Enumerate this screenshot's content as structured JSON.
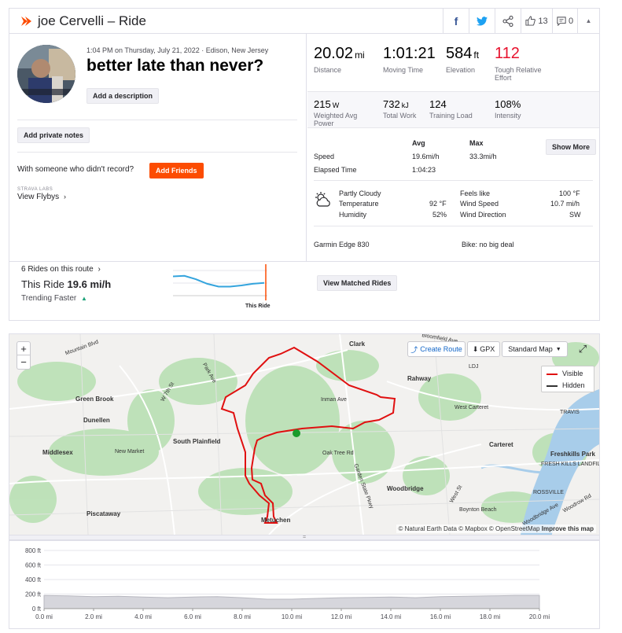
{
  "header": {
    "title": "joe Cervelli – Ride",
    "kudos_count": "13",
    "comment_count": "0"
  },
  "activity": {
    "meta": "1:04 PM on Thursday, July 21, 2022 · Edison, New Jersey",
    "name": "better late than never?",
    "add_description": "Add a description",
    "add_private_notes": "Add private notes",
    "with_someone": "With someone who didn't record?",
    "add_friends": "Add Friends",
    "labs": "STRAVA LABS",
    "flybys": "View Flybys"
  },
  "segment_compare": {
    "rides_on_route": "6 Rides on this route",
    "this_ride_label": "This Ride",
    "this_ride_value": "19.6 mi/h",
    "trend": "Trending Faster",
    "this_ride_marker": "This Ride",
    "matched_button": "View Matched Rides",
    "sparkline": [
      0.32,
      0.3,
      0.42,
      0.58,
      0.68,
      0.68,
      0.64,
      0.58,
      0.55
    ]
  },
  "stats_primary": [
    {
      "value": "20.02",
      "unit": "mi",
      "label": "Distance"
    },
    {
      "value": "1:01:21",
      "unit": "",
      "label": "Moving Time"
    },
    {
      "value": "584",
      "unit": "ft",
      "label": "Elevation"
    },
    {
      "value": "112",
      "unit": "",
      "label": "Tough Relative Effort"
    }
  ],
  "stats_secondary": [
    {
      "value": "215",
      "unit": "W",
      "label": "Weighted Avg Power"
    },
    {
      "value": "732",
      "unit": "kJ",
      "label": "Total Work"
    },
    {
      "value": "124",
      "unit": "",
      "label": "Training Load"
    },
    {
      "value": "108%",
      "unit": "",
      "label": "Intensity"
    }
  ],
  "detail_table": {
    "col_avg": "Avg",
    "col_max": "Max",
    "show_more": "Show More",
    "speed_label": "Speed",
    "speed_avg": "19.6mi/h",
    "speed_max": "33.3mi/h",
    "elapsed_label": "Elapsed Time",
    "elapsed_value": "1:04:23"
  },
  "weather": {
    "condition": "Partly Cloudy",
    "temperature_label": "Temperature",
    "temperature": "92 °F",
    "humidity_label": "Humidity",
    "humidity": "52%",
    "feels_like_label": "Feels like",
    "feels_like": "100 °F",
    "wind_speed_label": "Wind Speed",
    "wind_speed": "10.7 mi/h",
    "wind_dir_label": "Wind Direction",
    "wind_dir": "SW"
  },
  "device": "Garmin Edge 830",
  "bike": "Bike: no big deal",
  "map": {
    "zoom_in": "+",
    "zoom_out": "−",
    "create_route": "Create Route",
    "gpx": "GPX",
    "map_type": "Standard Map",
    "legend_visible": "Visible",
    "legend_hidden": "Hidden",
    "attribution_1": "© Natural Earth Data © Mapbox © OpenStreetMap",
    "attribution_2": "Improve this map",
    "places": [
      {
        "name": "Clark",
        "size": "b"
      },
      {
        "name": "Rahway",
        "size": "b"
      },
      {
        "name": "Green Brook",
        "size": "b"
      },
      {
        "name": "Dunellen",
        "size": "b"
      },
      {
        "name": "Middlesex",
        "size": "b"
      },
      {
        "name": "New Market",
        "size": "s"
      },
      {
        "name": "South Plainfield",
        "size": "b"
      },
      {
        "name": "Piscataway",
        "size": "b"
      },
      {
        "name": "Metuchen",
        "size": "b"
      },
      {
        "name": "Woodbridge",
        "size": "b"
      },
      {
        "name": "Carteret",
        "size": "b"
      },
      {
        "name": "West Carteret",
        "size": "s"
      },
      {
        "name": "Freshkills Park",
        "size": "b"
      },
      {
        "name": "FRESH KILLS LANDFILL",
        "size": "s"
      },
      {
        "name": "Boynton Beach",
        "size": "s"
      },
      {
        "name": "Inman Ave",
        "size": "s"
      },
      {
        "name": "Oak Tree Rd",
        "size": "s"
      },
      {
        "name": "LDJ",
        "size": "s"
      },
      {
        "name": "TRAVIS",
        "size": "s"
      },
      {
        "name": "ROSSVILLE",
        "size": "s"
      },
      {
        "name": "Mountain Blvd",
        "size": "s"
      },
      {
        "name": "W 7th St",
        "size": "s"
      },
      {
        "name": "Park Ave",
        "size": "s"
      },
      {
        "name": "Garden State Pkwy",
        "size": "s"
      },
      {
        "name": "Woodbridge Ave",
        "size": "s"
      },
      {
        "name": "West St",
        "size": "s"
      },
      {
        "name": "Woodrow Rd",
        "size": "s"
      },
      {
        "name": "Bloomfield Ave",
        "size": "s"
      }
    ]
  },
  "chart_data": {
    "type": "area",
    "title": "",
    "xlabel": "",
    "ylabel": "",
    "x_ticks": [
      "0.0 mi",
      "2.0 mi",
      "4.0 mi",
      "6.0 mi",
      "8.0 mi",
      "10.0 mi",
      "12.0 mi",
      "14.0 mi",
      "16.0 mi",
      "18.0 mi",
      "20.0 mi"
    ],
    "y_ticks": [
      "0 ft",
      "200 ft",
      "400 ft",
      "600 ft",
      "800 ft"
    ],
    "xlim": [
      0,
      20
    ],
    "ylim": [
      0,
      800
    ],
    "x": [
      0,
      1,
      2,
      3,
      4,
      5,
      6,
      7,
      8,
      9,
      10,
      11,
      12,
      13,
      14,
      15,
      16,
      17,
      18,
      19,
      20
    ],
    "elevation_ft": [
      180,
      175,
      165,
      170,
      160,
      150,
      160,
      165,
      150,
      130,
      130,
      140,
      150,
      155,
      160,
      150,
      165,
      170,
      175,
      180,
      180
    ]
  }
}
